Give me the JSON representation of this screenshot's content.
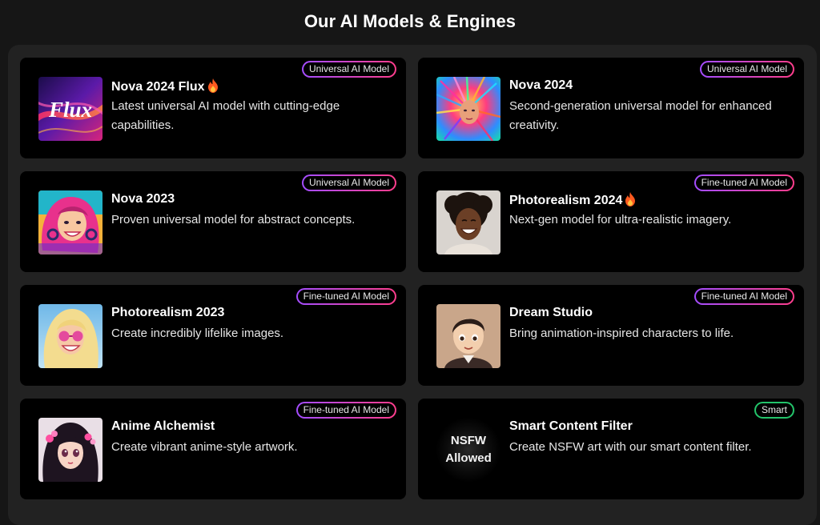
{
  "page": {
    "title": "Our AI Models & Engines"
  },
  "colors": {
    "badge_gradient_start": "#a34dff",
    "badge_gradient_end": "#ff3d8b",
    "smart_badge": "#23c46a",
    "card_bg": "#000000",
    "panel_bg": "#222222"
  },
  "models": [
    {
      "name": "Nova 2024 Flux",
      "hot": true,
      "description": "Latest universal AI model with cutting-edge capabilities.",
      "badge": "Universal AI Model",
      "thumb_text": "Flux"
    },
    {
      "name": "Nova 2024",
      "hot": false,
      "description": "Second-generation universal model for enhanced creativity.",
      "badge": "Universal AI Model"
    },
    {
      "name": "Nova 2023",
      "hot": false,
      "description": "Proven universal model for abstract concepts.",
      "badge": "Universal AI Model"
    },
    {
      "name": "Photorealism 2024",
      "hot": true,
      "description": "Next-gen model for ultra-realistic imagery.",
      "badge": "Fine-tuned AI Model"
    },
    {
      "name": "Photorealism 2023",
      "hot": false,
      "description": "Create incredibly lifelike images.",
      "badge": "Fine-tuned AI Model"
    },
    {
      "name": "Dream Studio",
      "hot": false,
      "description": "Bring animation-inspired characters to life.",
      "badge": "Fine-tuned AI Model"
    },
    {
      "name": "Anime Alchemist",
      "hot": false,
      "description": "Create vibrant anime-style artwork.",
      "badge": "Fine-tuned AI Model"
    },
    {
      "name": "Smart Content Filter",
      "hot": false,
      "description": "Create NSFW art with our smart content filter.",
      "badge": "Smart",
      "thumb_line1": "NSFW",
      "thumb_line2": "Allowed"
    }
  ]
}
